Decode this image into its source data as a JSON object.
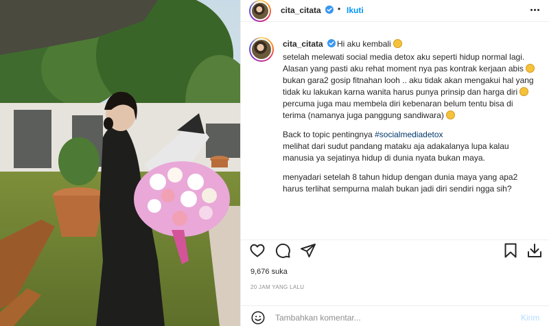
{
  "post": {
    "username": "cita_citata",
    "follow_label": "Ikuti",
    "dot": "•",
    "caption": {
      "greeting": "Hi aku kembali",
      "lines": [
        "setelah melewati social media detox aku seperti hidup normal lagi.",
        "Alasan yang pasti aku rehat moment nya pas kontrak kerjaan abis",
        "bukan gara2 gosip fitnahan looh .. aku tidak akan mengakui hal yang tidak ku lakukan karna wanita harus punya prinsip dan harga diri",
        "percuma juga mau membela diri kebenaran belum tentu bisa di terima (namanya juga panggung sandiwara)",
        "Back to topic pentingnya",
        "#socialmediadetox",
        "melihat dari sudut pandang mataku aja adakalanya lupa kalau manusia ya sejatinya hidup di dunia nyata bukan maya.",
        "menyadari setelah 8 tahun hidup dengan dunia maya yang apa2 harus terlihat sempurna malah bukan jadi diri sendiri ngga sih?"
      ]
    },
    "likes": "9,676 suka",
    "time": "20 JAM YANG LALU"
  },
  "comment": {
    "placeholder": "Tambahkan komentar...",
    "post_label": "Kirim"
  },
  "icons": {
    "verified": "verified-badge-icon",
    "like": "heart-icon",
    "comment": "comment-icon",
    "share": "send-icon",
    "save": "bookmark-icon",
    "download": "download-icon",
    "emoji": "smiley-icon",
    "more": "more-options-icon"
  },
  "colors": {
    "link": "#0095f6",
    "hashtag": "#00376b",
    "muted": "#8e8e8e",
    "verified": "#3897f0"
  }
}
